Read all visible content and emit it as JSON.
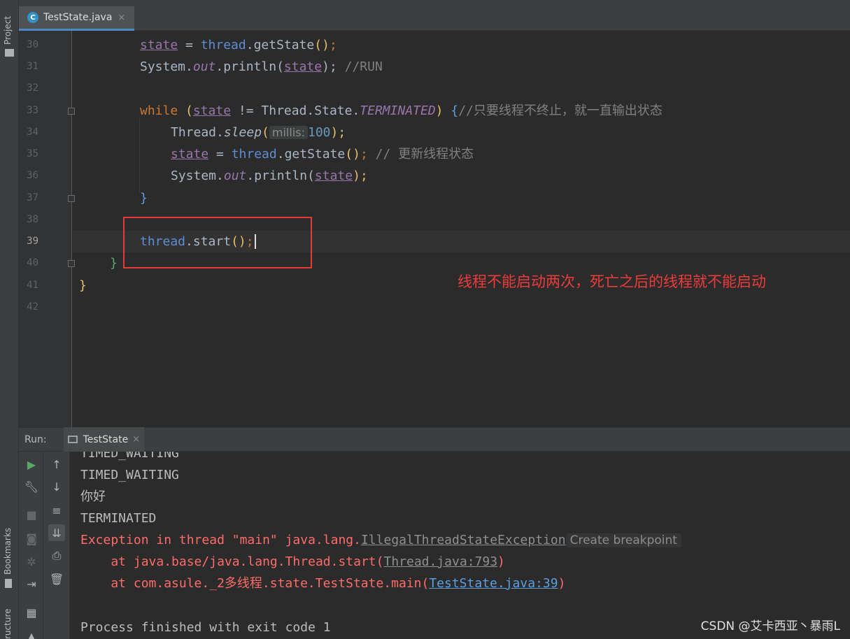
{
  "left_strip": {
    "project_label": "Project",
    "bookmarks_label": "Bookmarks",
    "structure_label": "ructure"
  },
  "editor_tab": {
    "icon_letter": "C",
    "label": "TestState.java",
    "close": "×"
  },
  "editor": {
    "line_numbers": [
      "30",
      "31",
      "32",
      "33",
      "34",
      "35",
      "36",
      "37",
      "38",
      "39",
      "40",
      "41",
      "42"
    ],
    "lines": {
      "l30": {
        "state": "state",
        "eq": " = ",
        "thread": "thread",
        "call": ".getState",
        "paren": "()",
        "semi": ";"
      },
      "l31": {
        "sys": "System.",
        "out": "out",
        "println": ".println(",
        "state": "state",
        "close": ");",
        "comment": " //RUN"
      },
      "l33": {
        "kw": "while",
        "sp": " ",
        "open": "(",
        "state": "state",
        "ne": " != Thread.State.",
        "term": "TERMINATED",
        "close": ")",
        "sp2": " ",
        "brace": "{",
        "comment": "//只要线程不终止，就一直输出状态"
      },
      "l34": {
        "cls": "Thread.",
        "sleep": "sleep",
        "open": "(",
        "hint": "millis:",
        "num": "100",
        "close": ");"
      },
      "l35": {
        "state": "state",
        "eq": " = ",
        "thread": "thread",
        "call": ".getState",
        "paren": "()",
        "semi": ";",
        "comment": " // 更新线程状态"
      },
      "l36": {
        "sys": "System.",
        "out": "out",
        "println": ".println(",
        "state": "state",
        "close": ");"
      },
      "l37": {
        "brace": "}"
      },
      "l39": {
        "thread": "thread",
        "call": ".start",
        "paren": "()",
        "semi": ";"
      },
      "l40": {
        "brace": "}"
      },
      "l41": {
        "brace": "}"
      }
    }
  },
  "annotation": "线程不能启动两次，死亡之后的线程就不能启动",
  "run_panel": {
    "label": "Run:",
    "tab_label": "TestState",
    "close": "×",
    "toolbar1_icons": [
      "run-icon",
      "wrench-icon",
      "stop-icon",
      "camera-icon",
      "settings-icon",
      "login-icon",
      "layout-icon",
      "pin-icon"
    ],
    "toolbar2_icons": [
      "arrow-up-icon",
      "arrow-down-icon",
      "soft-wrap-icon",
      "scroll-end-icon",
      "print-icon",
      "trash-icon"
    ]
  },
  "console": {
    "lines": [
      "TIMED_WAITING",
      "TIMED_WAITING",
      "你好",
      "TERMINATED"
    ],
    "exception": {
      "prefix": "Exception in thread \"main\" java.lang.",
      "class": "IllegalThreadStateException",
      "hint": "Create breakpoint"
    },
    "at1": {
      "prefix": "    at java.base/java.lang.Thread.start(",
      "link": "Thread.java:793",
      "suffix": ")"
    },
    "at2": {
      "prefix": "    at com.asule._2多线程.state.TestState.main(",
      "link": "TestState.java:39",
      "suffix": ")"
    },
    "finished": "Process finished with exit code 1"
  },
  "watermark": "CSDN @艾卡西亚丶暴雨L",
  "colors": {
    "keyword": "#cc7832",
    "field": "#9876aa",
    "error": "#ff6b68",
    "link": "#5c9fe0",
    "annotation": "#ee3b3b"
  }
}
